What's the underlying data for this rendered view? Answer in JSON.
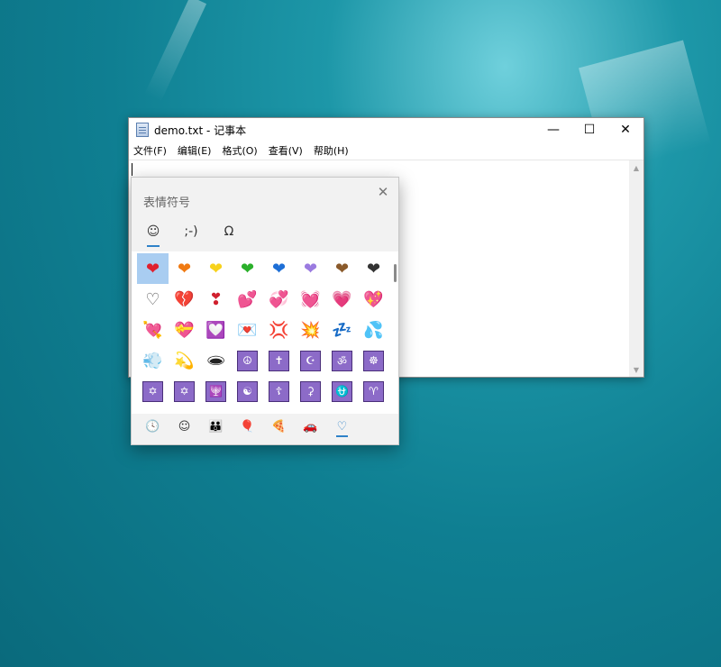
{
  "notepad": {
    "title": "demo.txt - 记事本",
    "minimize": "—",
    "maximize": "☐",
    "close": "✕",
    "menu": [
      "文件(F)",
      "编辑(E)",
      "格式(O)",
      "查看(V)",
      "帮助(H)"
    ],
    "scroll_up": "▲",
    "scroll_down": "▼"
  },
  "emoji_panel": {
    "title": "表情符号",
    "close": "✕",
    "tabs": [
      {
        "name": "emoji-tab",
        "glyph": "☺",
        "active": true
      },
      {
        "name": "kaomoji-tab",
        "glyph": ";-)",
        "active": false
      },
      {
        "name": "symbols-tab",
        "glyph": "Ω",
        "active": false
      }
    ],
    "emojis": [
      {
        "g": "❤",
        "c": "#e0202e",
        "name": "red-heart"
      },
      {
        "g": "❤",
        "c": "#f07a12",
        "name": "orange-heart"
      },
      {
        "g": "❤",
        "c": "#f7d21c",
        "name": "yellow-heart"
      },
      {
        "g": "❤",
        "c": "#2bb02b",
        "name": "green-heart"
      },
      {
        "g": "❤",
        "c": "#1e6fd6",
        "name": "blue-heart"
      },
      {
        "g": "❤",
        "c": "#9b7be0",
        "name": "purple-heart"
      },
      {
        "g": "❤",
        "c": "#8a5a2b",
        "name": "brown-heart"
      },
      {
        "g": "❤",
        "c": "#333333",
        "name": "black-heart"
      },
      {
        "g": "♡",
        "c": "#555555",
        "name": "white-heart"
      },
      {
        "g": "💔",
        "c": "#d0202e",
        "name": "broken-heart"
      },
      {
        "g": "❣",
        "c": "#d0202e",
        "name": "heart-exclamation"
      },
      {
        "g": "💕",
        "c": "#e05060",
        "name": "two-hearts"
      },
      {
        "g": "💞",
        "c": "#d03040",
        "name": "revolving-hearts"
      },
      {
        "g": "💓",
        "c": "#d02030",
        "name": "beating-heart"
      },
      {
        "g": "💗",
        "c": "#e0607a",
        "name": "growing-heart"
      },
      {
        "g": "💖",
        "c": "#d82a3c",
        "name": "sparkling-heart"
      },
      {
        "g": "💘",
        "c": "#d0202e",
        "name": "heart-with-arrow"
      },
      {
        "g": "💝",
        "c": "#e03030",
        "name": "heart-with-ribbon"
      },
      {
        "g": "💟",
        "c": "#d04a7a",
        "name": "heart-decoration"
      },
      {
        "g": "💌",
        "c": "#d03040",
        "name": "love-letter"
      },
      {
        "g": "💢",
        "c": "#d02020",
        "name": "anger-symbol"
      },
      {
        "g": "💥",
        "c": "#e05010",
        "name": "collision"
      },
      {
        "g": "💤",
        "c": "#2a78c8",
        "name": "zzz"
      },
      {
        "g": "💦",
        "c": "#3ab0d8",
        "name": "sweat-droplets"
      },
      {
        "g": "💨",
        "c": "#444444",
        "name": "dashing-away"
      },
      {
        "g": "💫",
        "c": "#2a8a8a",
        "name": "dizzy"
      },
      {
        "g": "🕳",
        "c": "#222222",
        "name": "hole"
      },
      {
        "g": "☮",
        "c": "#ffffff",
        "name": "peace-symbol",
        "box": true
      },
      {
        "g": "✝",
        "c": "#ffffff",
        "name": "latin-cross",
        "box": true
      },
      {
        "g": "☪",
        "c": "#ffffff",
        "name": "star-and-crescent",
        "box": true
      },
      {
        "g": "ॐ",
        "c": "#ffffff",
        "name": "om",
        "box": true
      },
      {
        "g": "☸",
        "c": "#ffffff",
        "name": "wheel-of-dharma",
        "box": true
      },
      {
        "g": "✡",
        "c": "#ffffff",
        "name": "star-of-david",
        "box": true
      },
      {
        "g": "✡",
        "c": "#ffffff",
        "name": "dotted-six-pointed-star",
        "box": true
      },
      {
        "g": "🕎",
        "c": "#ffffff",
        "name": "menorah",
        "box": true
      },
      {
        "g": "☯",
        "c": "#ffffff",
        "name": "yin-yang",
        "box": true
      },
      {
        "g": "☦",
        "c": "#ffffff",
        "name": "orthodox-cross",
        "box": true
      },
      {
        "g": "⚳",
        "c": "#ffffff",
        "name": "place-of-worship",
        "box": true
      },
      {
        "g": "⛎",
        "c": "#ffffff",
        "name": "ophiuchus",
        "box": true
      },
      {
        "g": "♈",
        "c": "#ffffff",
        "name": "aries",
        "box": true
      }
    ],
    "sub_tabs": [
      {
        "name": "recent-tab",
        "glyph": "🕓",
        "active": false
      },
      {
        "name": "smiley-tab",
        "glyph": "☺",
        "active": false
      },
      {
        "name": "people-tab",
        "glyph": "👪",
        "active": false
      },
      {
        "name": "celebration-tab",
        "glyph": "🎈",
        "active": false
      },
      {
        "name": "food-tab",
        "glyph": "🍕",
        "active": false
      },
      {
        "name": "travel-tab",
        "glyph": "🚗",
        "active": false
      },
      {
        "name": "heart-tab",
        "glyph": "♡",
        "active": true
      }
    ]
  }
}
